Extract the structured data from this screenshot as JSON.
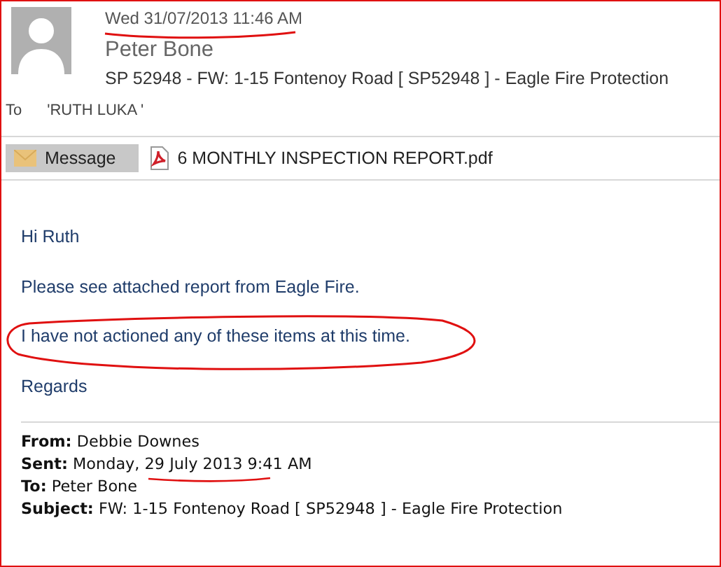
{
  "message": {
    "date": "Wed 31/07/2013 11:46 AM",
    "sender": "Peter Bone",
    "subject": "SP 52948 - FW: 1-15 Fontenoy Road [ SP52948 ] - Eagle Fire Protection",
    "to_label": "To",
    "to": "'RUTH  LUKA '"
  },
  "attachments": [
    {
      "kind": "message",
      "label": "Message",
      "selected": true
    },
    {
      "kind": "pdf",
      "label": "6 MONTHLY INSPECTION REPORT.pdf",
      "selected": false
    }
  ],
  "body": [
    "Hi Ruth",
    "Please see attached report from Eagle Fire.",
    "I have not actioned any of these items at this time.",
    "Regards"
  ],
  "quoted_header": [
    {
      "label": "From:",
      "value": "Debbie Downes"
    },
    {
      "label": "Sent:",
      "value": "Monday, 29 July 2013 9:41 AM"
    },
    {
      "label": "To:",
      "value": "Peter Bone"
    },
    {
      "label": "Subject:",
      "value": "FW: 1-15 Fontenoy Road [ SP52948 ] - Eagle Fire Protection"
    }
  ]
}
